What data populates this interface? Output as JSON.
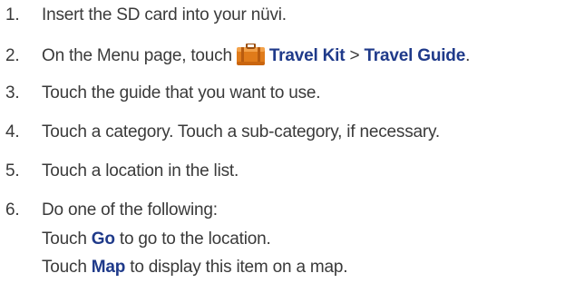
{
  "steps": [
    {
      "num": "1.",
      "text": "Insert the SD card into your nüvi."
    },
    {
      "num": "2.",
      "pre": "On the Menu page, touch",
      "icon": "travel-kit-suitcase-icon",
      "kw1": "Travel Kit",
      "sep": " > ",
      "kw2": "Travel Guide",
      "post": "."
    },
    {
      "num": "3.",
      "text": "Touch the guide that you want to use."
    },
    {
      "num": "4.",
      "text": "Touch a category. Touch a sub-category, if necessary."
    },
    {
      "num": "5.",
      "text": "Touch a location in the list."
    },
    {
      "num": "6.",
      "text": "Do one of the following:"
    }
  ],
  "substeps": [
    {
      "pre": "Touch ",
      "kw": "Go",
      "post": " to go to the location."
    },
    {
      "pre": "Touch ",
      "kw": "Map",
      "post": " to display this item on a map."
    }
  ],
  "colors": {
    "text": "#3a3a3a",
    "keyword": "#1f3a8a",
    "icon": "#e07b1a"
  }
}
